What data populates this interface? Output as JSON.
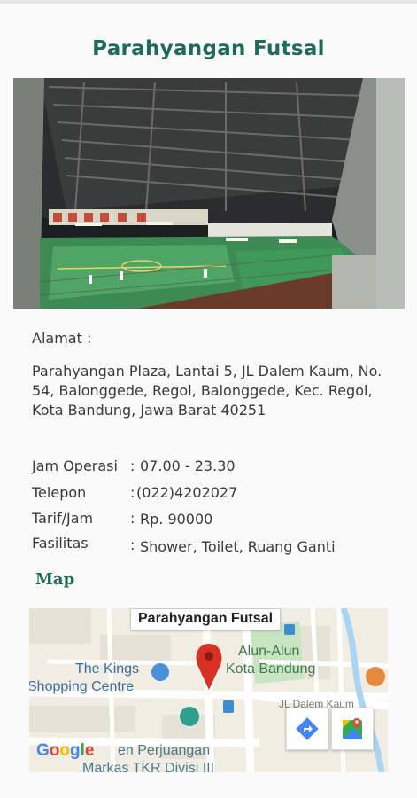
{
  "title": "Parahyangan Futsal",
  "photo": {
    "description_icon": "futsal-hall-photo"
  },
  "address": {
    "label": "Alamat :",
    "text": "Parahyangan Plaza, Lantai 5, JL Dalem Kaum, No. 54, Balonggede, Regol, Balonggede, Kec. Regol, Kota Bandung, Jawa Barat 40251"
  },
  "details": [
    {
      "key": "Jam Operasi",
      "colon": ":",
      "value": "07.00 - 23.30"
    },
    {
      "key": "Telepon",
      "colon": ":",
      "value": "(022)4202027"
    },
    {
      "key": "Tarif/Jam",
      "colon": ":",
      "value": "Rp. 90000"
    },
    {
      "key": "Fasilitas",
      "colon": ":",
      "value": "Shower, Toilet, Ruang Ganti"
    }
  ],
  "map": {
    "heading": "Map",
    "marker_title": "Parahyangan Futsal",
    "places": {
      "alun_line1": "Alun-Alun",
      "alun_line2": "Kota Bandung",
      "kings_line1": "The Kings",
      "kings_line2": "Shopping Centre",
      "street": "JL Dalem Kaum",
      "bottom_line1": "en Perjuangan",
      "bottom_line2": "Markas TKR Divisi III"
    },
    "logo": {
      "g1": "G",
      "o1": "o",
      "o2": "o",
      "g2": "g",
      "l": "l",
      "e": "e"
    },
    "colors": {
      "marker": "#d93025",
      "accent": "#1f6b5a",
      "link_blue": "#3b6ea8"
    }
  }
}
